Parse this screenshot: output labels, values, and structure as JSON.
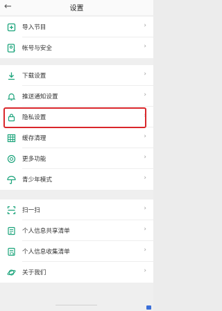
{
  "header": {
    "back_icon": "arrow-left-icon",
    "title": "设置"
  },
  "groups": [
    {
      "items": [
        {
          "icon": "import-icon",
          "label": "导入节目"
        },
        {
          "icon": "account-security-icon",
          "label": "帐号与安全"
        }
      ]
    },
    {
      "items": [
        {
          "icon": "download-icon",
          "label": "下载设置"
        },
        {
          "icon": "bell-icon",
          "label": "推送通知设置"
        },
        {
          "icon": "lock-icon",
          "label": "隐私设置",
          "highlighted": true
        },
        {
          "icon": "cache-clean-icon",
          "label": "缓存清理"
        },
        {
          "icon": "more-functions-icon",
          "label": "更多功能"
        },
        {
          "icon": "umbrella-icon",
          "label": "青少年模式"
        }
      ]
    },
    {
      "items": [
        {
          "icon": "scan-icon",
          "label": "扫一扫"
        },
        {
          "icon": "share-list-icon",
          "label": "个人信息共享清单"
        },
        {
          "icon": "collect-list-icon",
          "label": "个人信息收集清单"
        },
        {
          "icon": "planet-icon",
          "label": "关于我们"
        }
      ]
    }
  ],
  "chevron": "›",
  "colors": {
    "accent": "#1aa37a",
    "highlight": "#d9262a"
  }
}
